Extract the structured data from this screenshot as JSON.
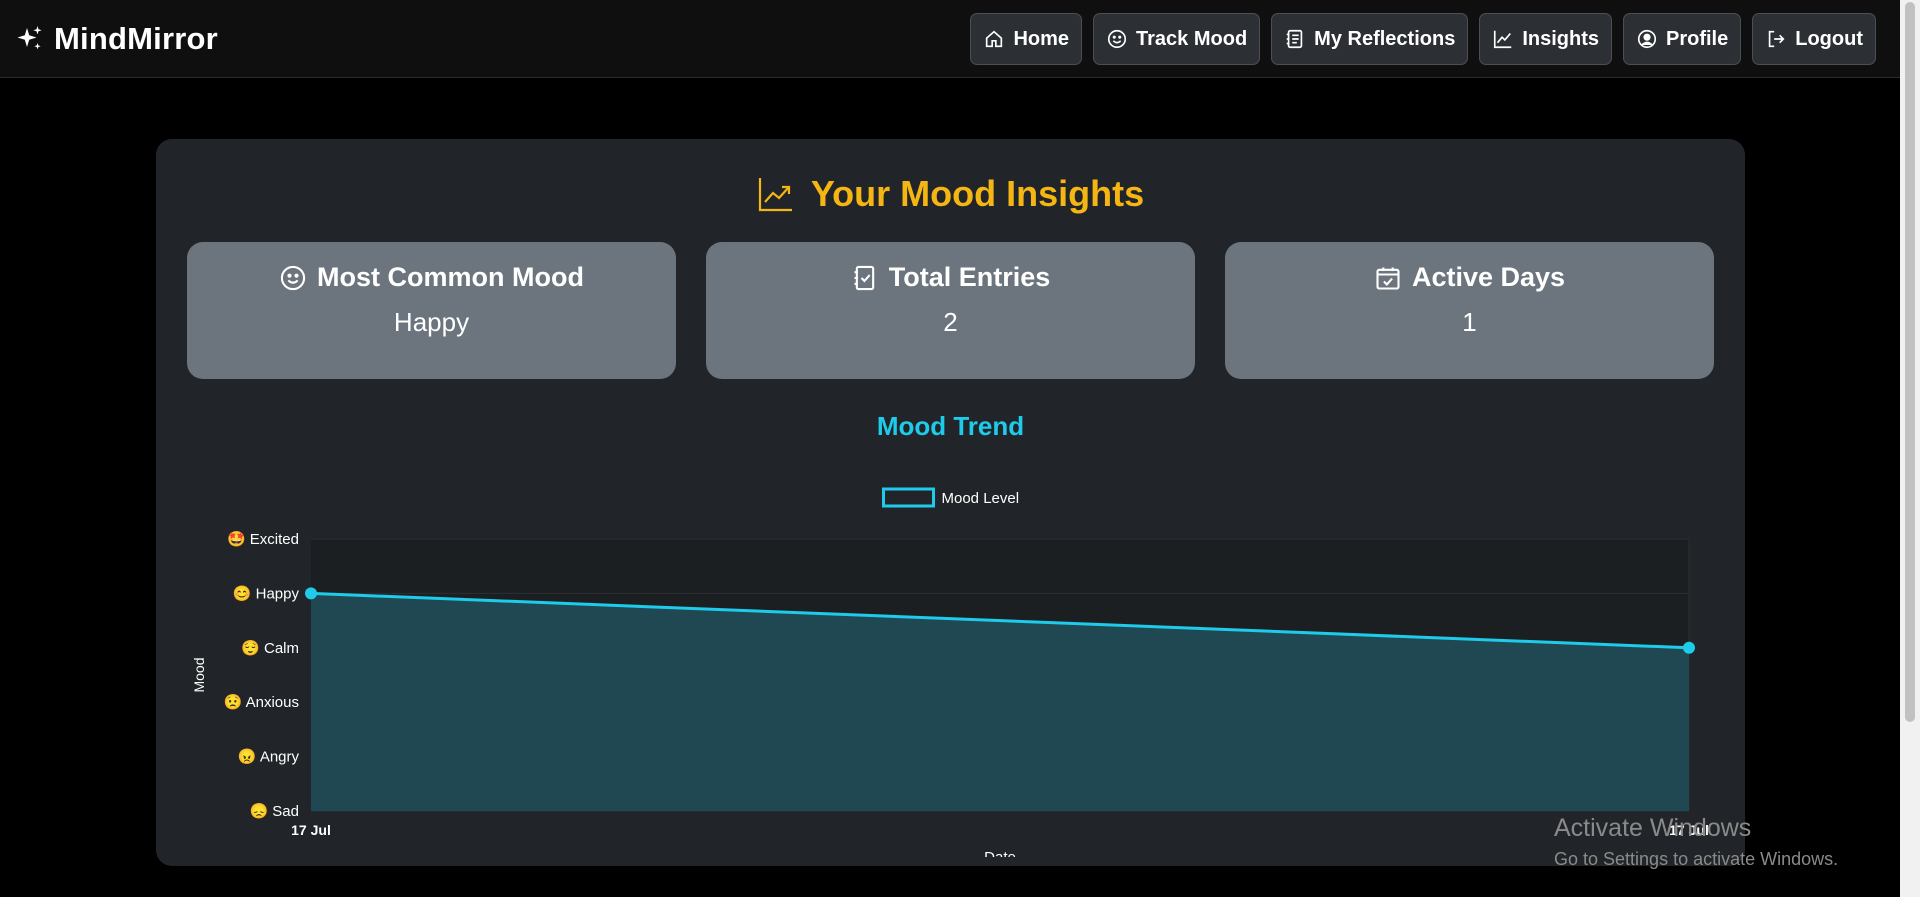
{
  "brand": {
    "name": "MindMirror",
    "icon": "sparkles-icon"
  },
  "nav": [
    {
      "label": "Home",
      "icon": "house-icon"
    },
    {
      "label": "Track Mood",
      "icon": "smiley-icon"
    },
    {
      "label": "My Reflections",
      "icon": "journal-icon"
    },
    {
      "label": "Insights",
      "icon": "graph-up-icon"
    },
    {
      "label": "Profile",
      "icon": "person-circle-icon"
    },
    {
      "label": "Logout",
      "icon": "logout-icon"
    }
  ],
  "page": {
    "title": "Your Mood Insights",
    "title_icon": "graph-up-arrow-icon"
  },
  "stats": [
    {
      "label": "Most Common Mood",
      "value": "Happy",
      "icon": "smiley-icon"
    },
    {
      "label": "Total Entries",
      "value": "2",
      "icon": "journal-check-icon"
    },
    {
      "label": "Active Days",
      "value": "1",
      "icon": "calendar-check-icon"
    }
  ],
  "colors": {
    "accent_gold": "#f5b614",
    "accent_cyan": "#1ecbea",
    "card_bg": "#212529",
    "stat_bg": "#6c757d",
    "area_fill": "#1f4852"
  },
  "chart_data": {
    "type": "area",
    "title": "Mood Trend",
    "xlabel": "Date",
    "ylabel": "Mood",
    "x": [
      "17 Jul",
      "17 Jul"
    ],
    "y_categories": [
      {
        "label": "Sad",
        "emoji": "😞"
      },
      {
        "label": "Angry",
        "emoji": "😠"
      },
      {
        "label": "Anxious",
        "emoji": "😟"
      },
      {
        "label": "Calm",
        "emoji": "😌"
      },
      {
        "label": "Happy",
        "emoji": "😊"
      },
      {
        "label": "Excited",
        "emoji": "🤩"
      }
    ],
    "series": [
      {
        "name": "Mood Level",
        "values": [
          "Happy",
          "Calm"
        ],
        "color": "#1ecbea"
      }
    ],
    "grid": true,
    "legend": "top-center"
  },
  "watermark": {
    "line1": "Activate Windows",
    "line2": "Go to Settings to activate Windows."
  }
}
